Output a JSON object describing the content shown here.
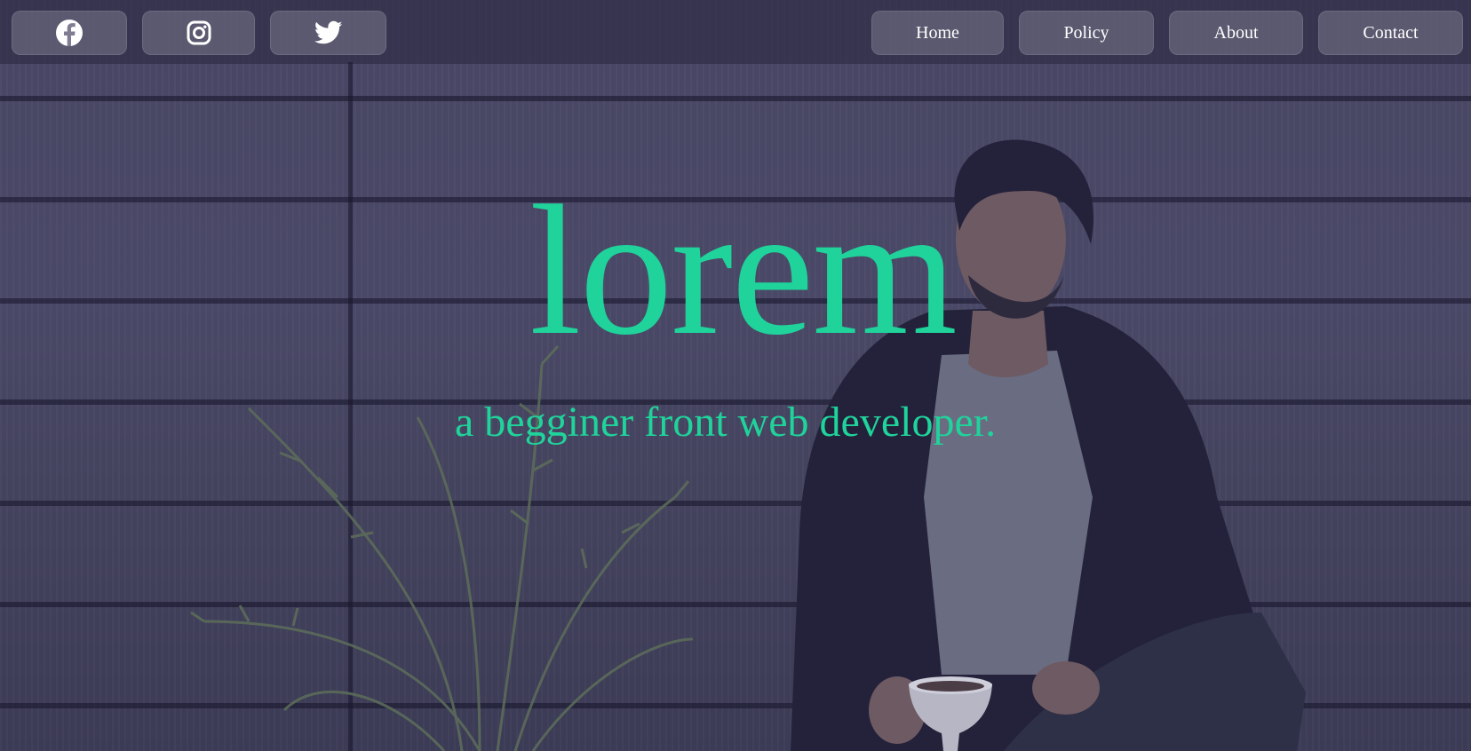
{
  "social": [
    {
      "name": "facebook-icon"
    },
    {
      "name": "instagram-icon"
    },
    {
      "name": "twitter-icon"
    }
  ],
  "nav": {
    "items": [
      {
        "label": "Home"
      },
      {
        "label": "Policy"
      },
      {
        "label": "About"
      },
      {
        "label": "Contact"
      }
    ]
  },
  "hero": {
    "title": "lorem",
    "subtitle": "a begginer front web developer."
  },
  "colors": {
    "accent": "#1fd39b",
    "overlay": "#4a4866",
    "button_bg": "#8d8ca0"
  }
}
